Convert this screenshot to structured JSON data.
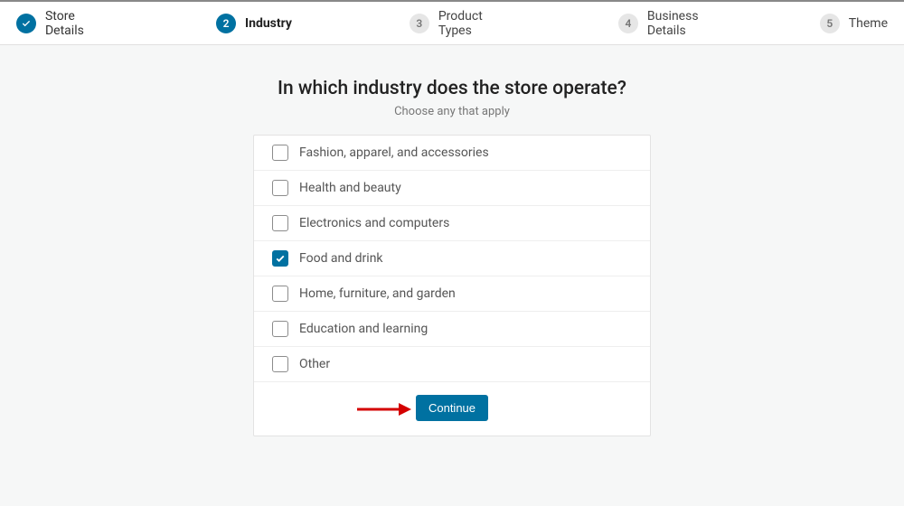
{
  "colors": {
    "accent": "#0071a1",
    "arrow": "#d40000"
  },
  "steps": [
    {
      "num": "1",
      "label": "Store Details",
      "state": "done"
    },
    {
      "num": "2",
      "label": "Industry",
      "state": "current"
    },
    {
      "num": "3",
      "label": "Product Types",
      "state": "pending"
    },
    {
      "num": "4",
      "label": "Business Details",
      "state": "pending"
    },
    {
      "num": "5",
      "label": "Theme",
      "state": "pending"
    }
  ],
  "heading": "In which industry does the store operate?",
  "subheading": "Choose any that apply",
  "options": [
    {
      "label": "Fashion, apparel, and accessories",
      "checked": false
    },
    {
      "label": "Health and beauty",
      "checked": false
    },
    {
      "label": "Electronics and computers",
      "checked": false
    },
    {
      "label": "Food and drink",
      "checked": true
    },
    {
      "label": "Home, furniture, and garden",
      "checked": false
    },
    {
      "label": "Education and learning",
      "checked": false
    },
    {
      "label": "Other",
      "checked": false
    }
  ],
  "buttons": {
    "continue": "Continue"
  }
}
